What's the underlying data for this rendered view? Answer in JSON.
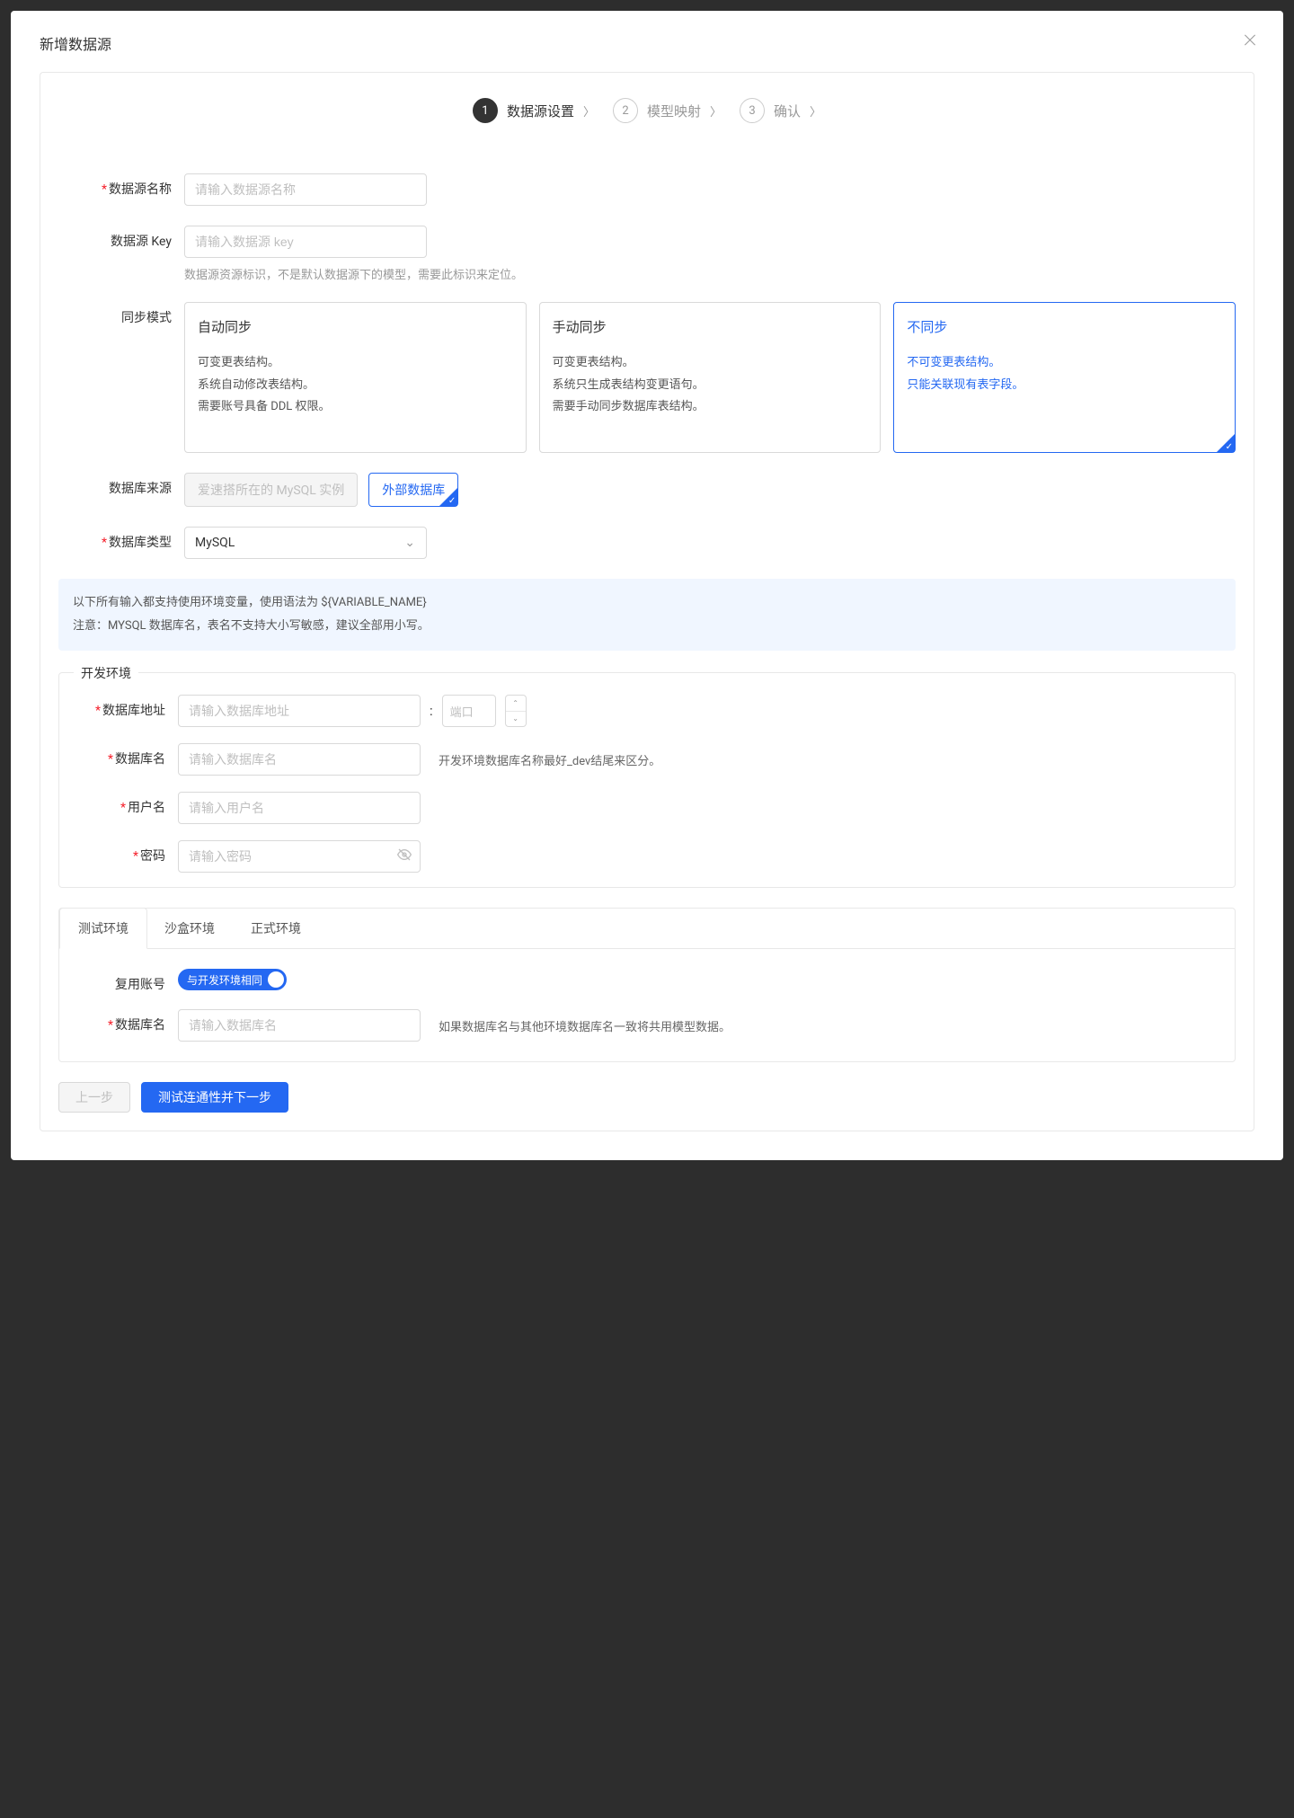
{
  "modal": {
    "title": "新增数据源"
  },
  "steps": {
    "items": [
      {
        "num": "1",
        "label": "数据源设置"
      },
      {
        "num": "2",
        "label": "模型映射"
      },
      {
        "num": "3",
        "label": "确认"
      }
    ]
  },
  "fields": {
    "dsName": {
      "label": "数据源名称",
      "placeholder": "请输入数据源名称"
    },
    "dsKey": {
      "label": "数据源 Key",
      "placeholder": "请输入数据源 key",
      "help": "数据源资源标识，不是默认数据源下的模型，需要此标识来定位。"
    },
    "syncMode": {
      "label": "同步模式",
      "options": [
        {
          "title": "自动同步",
          "desc": "可变更表结构。\n系统自动修改表结构。\n需要账号具备 DDL 权限。"
        },
        {
          "title": "手动同步",
          "desc": "可变更表结构。\n系统只生成表结构变更语句。\n需要手动同步数据库表结构。"
        },
        {
          "title": "不同步",
          "desc": "不可变更表结构。\n只能关联现有表字段。"
        }
      ]
    },
    "dbSource": {
      "label": "数据库来源",
      "options": [
        {
          "label": "爱速搭所在的 MySQL 实例"
        },
        {
          "label": "外部数据库"
        }
      ]
    },
    "dbType": {
      "label": "数据库类型",
      "value": "MySQL"
    },
    "info": {
      "line1": "以下所有输入都支持使用环境变量，使用语法为 ${VARIABLE_NAME}",
      "line2": "注意：MYSQL 数据库名，表名不支持大小写敏感，建议全部用小写。"
    },
    "devEnv": {
      "legend": "开发环境",
      "dbHost": {
        "label": "数据库地址",
        "placeholder": "请输入数据库地址",
        "port_placeholder": "端口"
      },
      "dbName": {
        "label": "数据库名",
        "placeholder": "请输入数据库名",
        "help": "开发环境数据库名称最好_dev结尾来区分。"
      },
      "user": {
        "label": "用户名",
        "placeholder": "请输入用户名"
      },
      "password": {
        "label": "密码",
        "placeholder": "请输入密码"
      }
    },
    "envTabs": {
      "tabs": [
        {
          "label": "测试环境"
        },
        {
          "label": "沙盒环境"
        },
        {
          "label": "正式环境"
        }
      ],
      "reuseAccount": {
        "label": "复用账号",
        "switchLabel": "与开发环境相同"
      },
      "dbName": {
        "label": "数据库名",
        "placeholder": "请输入数据库名",
        "help": "如果数据库名与其他环境数据库名一致将共用模型数据。"
      }
    }
  },
  "footer": {
    "prev": "上一步",
    "next": "测试连通性并下一步"
  }
}
